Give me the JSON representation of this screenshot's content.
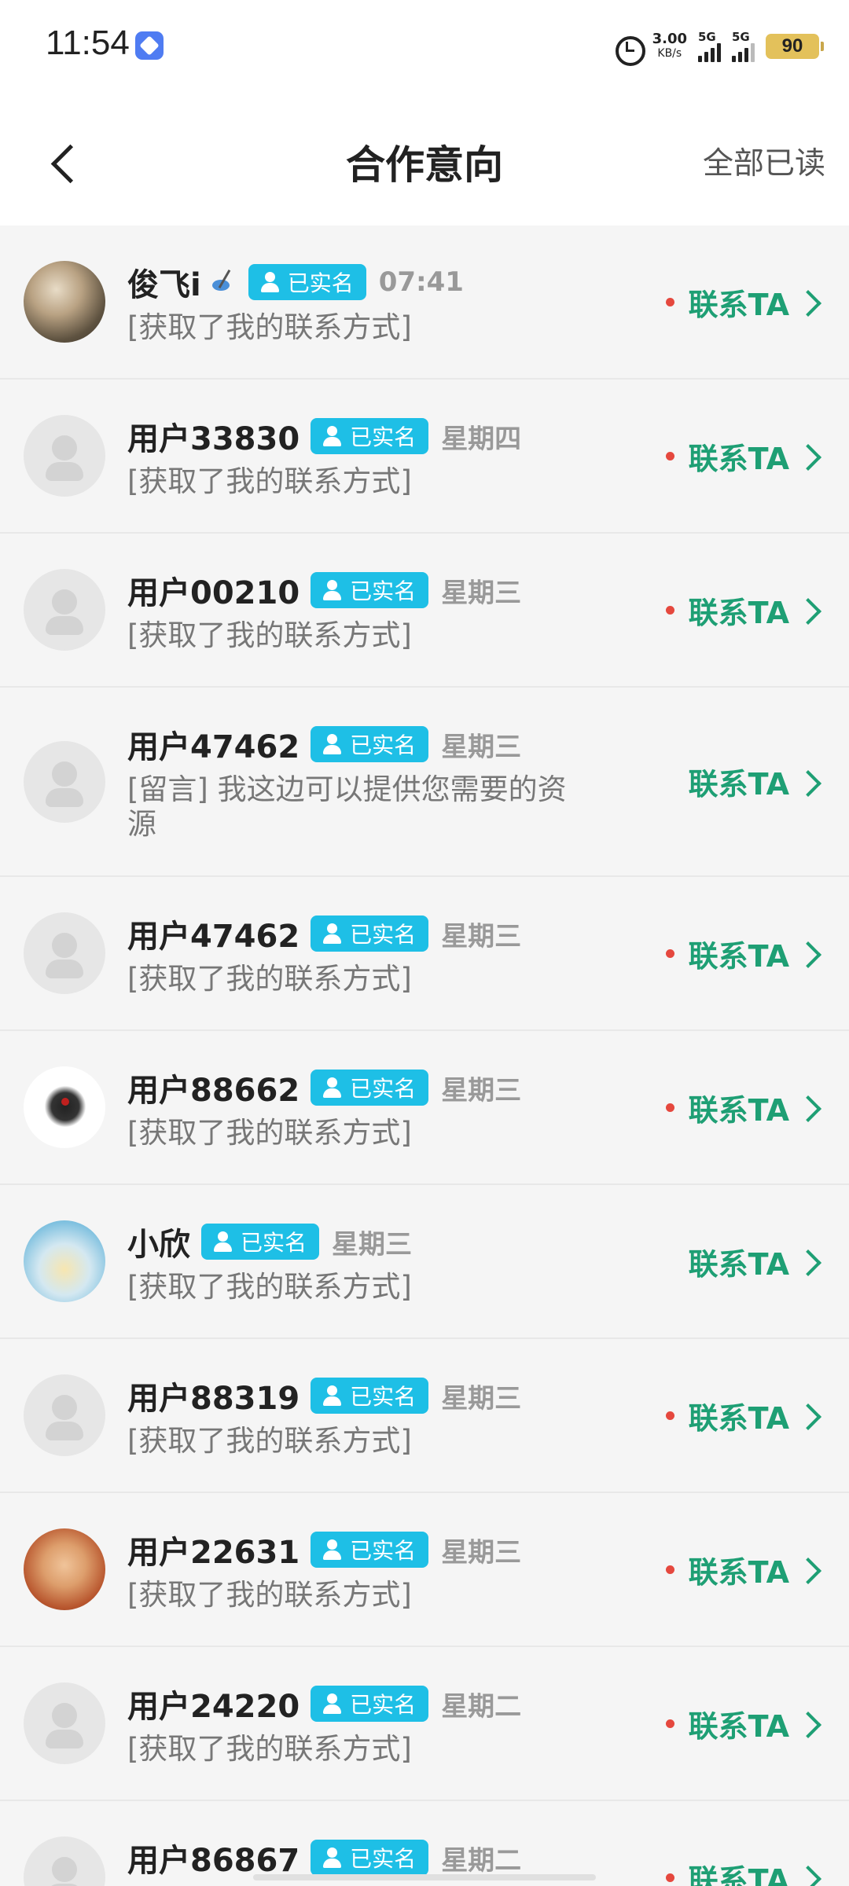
{
  "status_bar": {
    "time": "11:54",
    "net_speed_value": "3.00",
    "net_speed_unit": "KB/s",
    "signal1_label": "5G",
    "signal2_label": "5G",
    "battery": "90"
  },
  "header": {
    "title": "合作意向",
    "mark_all_read": "全部已读"
  },
  "badge_label": "已实名",
  "contact_label": "联系TA",
  "items": [
    {
      "name": "俊飞i",
      "time": "07:41",
      "message": "[获取了我的联系方式]",
      "unread": true
    },
    {
      "name": "用户33830",
      "time": "星期四",
      "message": "[获取了我的联系方式]",
      "unread": true
    },
    {
      "name": "用户00210",
      "time": "星期三",
      "message": "[获取了我的联系方式]",
      "unread": true
    },
    {
      "name": "用户47462",
      "time": "星期三",
      "message": "[留言] 我这边可以提供您需要的资源",
      "unread": false
    },
    {
      "name": "用户47462",
      "time": "星期三",
      "message": "[获取了我的联系方式]",
      "unread": true
    },
    {
      "name": "用户88662",
      "time": "星期三",
      "message": "[获取了我的联系方式]",
      "unread": true
    },
    {
      "name": "小欣",
      "time": "星期三",
      "message": "[获取了我的联系方式]",
      "unread": false
    },
    {
      "name": "用户88319",
      "time": "星期三",
      "message": "[获取了我的联系方式]",
      "unread": true
    },
    {
      "name": "用户22631",
      "time": "星期三",
      "message": "[获取了我的联系方式]",
      "unread": true
    },
    {
      "name": "用户24220",
      "time": "星期二",
      "message": "[获取了我的联系方式]",
      "unread": true
    },
    {
      "name": "用户86867",
      "time": "星期二",
      "message": "",
      "unread": true
    }
  ]
}
